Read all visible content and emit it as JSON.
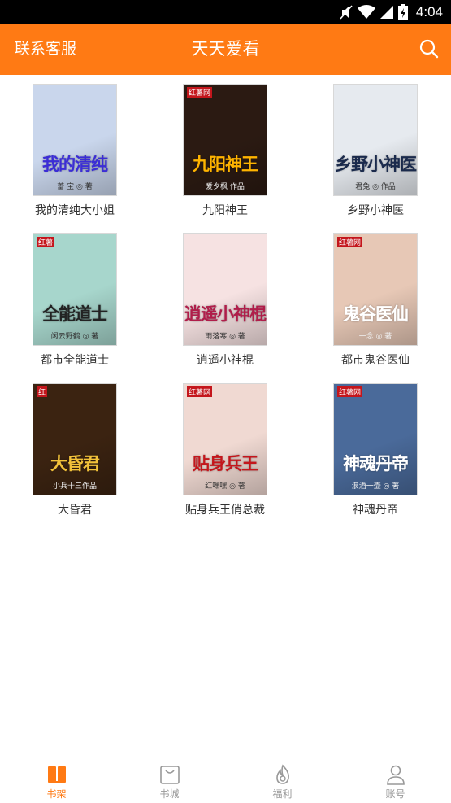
{
  "theme": {
    "accent": "#ff7a14",
    "tab_inactive": "#999999",
    "tab_active": "#ff7a14"
  },
  "status_bar": {
    "time": "4:04",
    "icons": [
      "mute-icon",
      "wifi-icon",
      "signal-icon",
      "battery-icon"
    ]
  },
  "header": {
    "contact_label": "联系客服",
    "title": "天天爱看",
    "search_icon": "search-icon"
  },
  "books": [
    {
      "name": "我的清纯大小姐",
      "cover_title": "我的清纯",
      "cover_author": "蕾 宝 ◎ 著",
      "cover_bg": "#c9d6ec",
      "cover_title_color": "#3b2dd6"
    },
    {
      "name": "九阳神王",
      "cover_title": "九阳神王",
      "cover_author": "爱夕枫 作品",
      "cover_tag": "红薯网",
      "cover_bg": "#2b1a12",
      "cover_title_color": "#ffb400"
    },
    {
      "name": "乡野小神医",
      "cover_title": "乡野小神医",
      "cover_author": "君兔 ◎ 作品",
      "cover_bg": "#e6eaef",
      "cover_title_color": "#1a2a4c"
    },
    {
      "name": "都市全能道士",
      "cover_title": "全能道士",
      "cover_author": "闲云野鹤 ◎ 著",
      "cover_tag": "红薯",
      "cover_bg": "#a7d6cc",
      "cover_title_color": "#222222"
    },
    {
      "name": "逍遥小神棍",
      "cover_title": "逍遥小神棍",
      "cover_author": "雨落寒 ◎ 著",
      "cover_bg": "#f6e2e2",
      "cover_title_color": "#b01d4a"
    },
    {
      "name": "都市鬼谷医仙",
      "cover_title": "鬼谷医仙",
      "cover_author": "一念 ◎ 著",
      "cover_tag": "红薯网",
      "cover_bg": "#e7c8b6",
      "cover_title_color": "#ffffff"
    },
    {
      "name": "大昏君",
      "cover_title": "大昏君",
      "cover_author": "小兵十三作品",
      "cover_tag": "红",
      "cover_bg": "#3b2311",
      "cover_title_color": "#f2c23a"
    },
    {
      "name": "贴身兵王俏总裁",
      "cover_title": "贴身兵王",
      "cover_author": "红嘿嘿 ◎ 著",
      "cover_tag": "红薯网",
      "cover_bg": "#f0d9d2",
      "cover_title_color": "#c4161c"
    },
    {
      "name": "神魂丹帝",
      "cover_title": "神魂丹帝",
      "cover_author": "浪酒一壶 ◎ 著",
      "cover_tag": "红薯网",
      "cover_bg": "#4a6a9a",
      "cover_title_color": "#ffffff"
    }
  ],
  "tabs": [
    {
      "label": "书架",
      "icon": "bookshelf-icon",
      "active": true
    },
    {
      "label": "书城",
      "icon": "store-bag-icon",
      "active": false
    },
    {
      "label": "福利",
      "icon": "flame-icon",
      "active": false
    },
    {
      "label": "账号",
      "icon": "account-icon",
      "active": false
    }
  ]
}
